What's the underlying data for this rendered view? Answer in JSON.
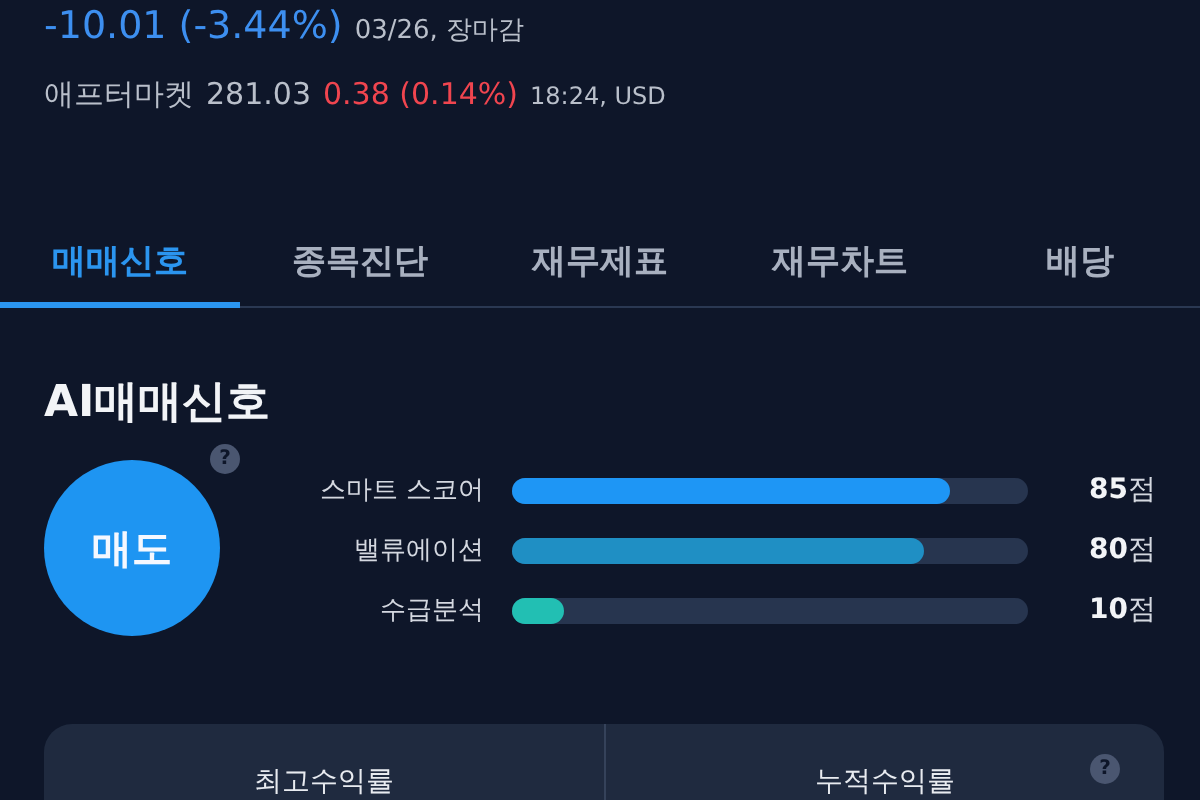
{
  "quote": {
    "change": "-10.01 (-3.44%)",
    "date": "03/26, 장마감"
  },
  "after_market": {
    "label": "애프터마켓",
    "price": "281.03",
    "change": "0.38 (0.14%)",
    "info": "18:24, USD"
  },
  "tabs": [
    {
      "label": "매매신호",
      "selected": true
    },
    {
      "label": "종목진단",
      "selected": false
    },
    {
      "label": "재무제표",
      "selected": false
    },
    {
      "label": "재무차트",
      "selected": false
    },
    {
      "label": "배당",
      "selected": false
    }
  ],
  "signal": {
    "title": "AI매매신호",
    "verdict": "매도",
    "help": "?",
    "metrics": [
      {
        "name": "스마트 스코어",
        "level": 0.85,
        "score": "**85**점",
        "color": "#1e96f5"
      },
      {
        "name": "밸류에이션",
        "level": 0.8,
        "score": "**80**점",
        "color": "#1f8fc4"
      },
      {
        "name": "수급분석",
        "level": 0.1,
        "score": "**10**점",
        "color": "#22bfb3"
      }
    ]
  },
  "returns": {
    "columns": [
      "최고수익률",
      "누적수익률"
    ],
    "help": "?"
  }
}
